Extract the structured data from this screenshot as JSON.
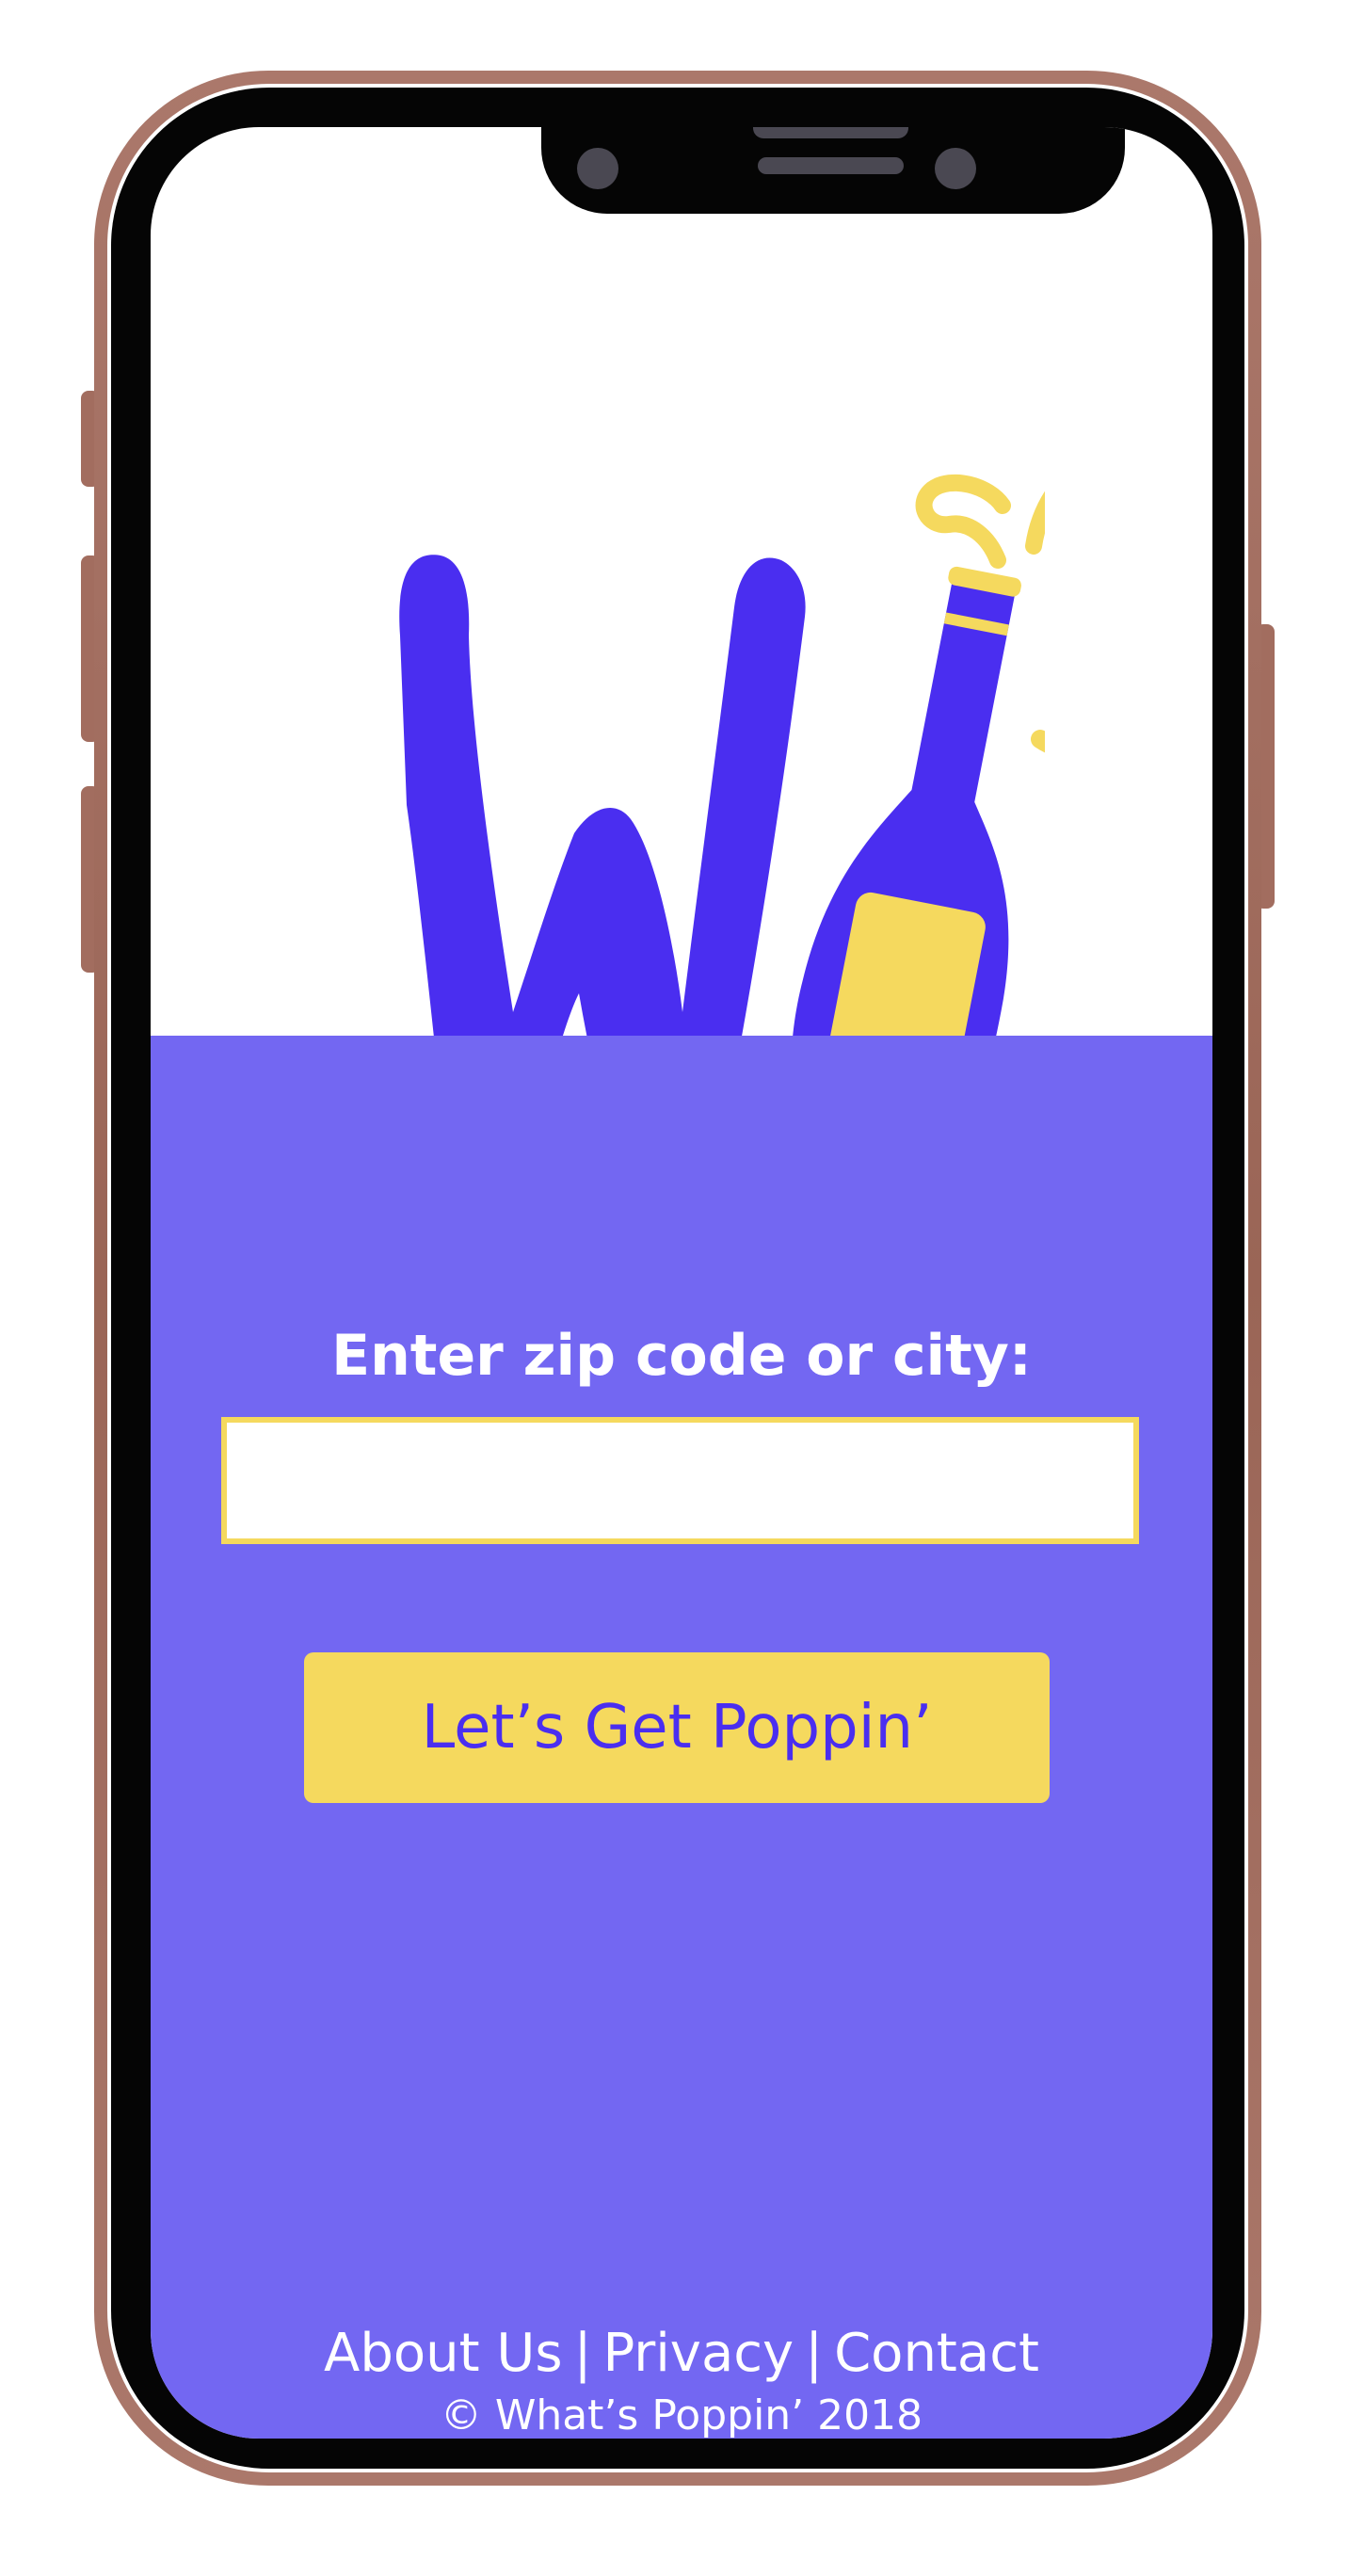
{
  "colors": {
    "brand_purple": "#4a2ef0",
    "panel_purple": "#7367f2",
    "accent_yellow": "#f5d95e",
    "frame_rose": "#a26d5f"
  },
  "logo": {
    "icon": "what-s-poppin-logo-w-champagne-bottle"
  },
  "search": {
    "label": "Enter zip code or city:",
    "value": "",
    "placeholder": ""
  },
  "cta": {
    "label": "Let’s Get Poppin’"
  },
  "footer": {
    "links": [
      "About Us",
      "Privacy",
      "Contact"
    ],
    "separator": "|",
    "copyright": "© What’s Poppin’ 2018"
  }
}
